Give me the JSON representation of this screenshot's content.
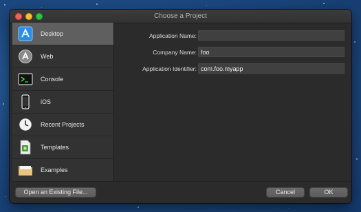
{
  "window": {
    "title": "Choose a Project"
  },
  "sidebar": {
    "items": [
      {
        "label": "Desktop",
        "icon": "desktop-app-icon",
        "selected": true
      },
      {
        "label": "Web",
        "icon": "web-app-icon",
        "selected": false
      },
      {
        "label": "Console",
        "icon": "console-icon",
        "selected": false
      },
      {
        "label": "iOS",
        "icon": "ios-device-icon",
        "selected": false
      },
      {
        "label": "Recent Projects",
        "icon": "clock-icon",
        "selected": false
      },
      {
        "label": "Templates",
        "icon": "templates-icon",
        "selected": false
      },
      {
        "label": "Examples",
        "icon": "folder-icon",
        "selected": false
      }
    ]
  },
  "form": {
    "application_name": {
      "label": "Application Name:",
      "value": ""
    },
    "company_name": {
      "label": "Company Name:",
      "value": "foo"
    },
    "application_identifier": {
      "label": "Application Identifier:",
      "value": "com.foo.myapp"
    }
  },
  "footer": {
    "open_existing_label": "Open an Existing File...",
    "cancel_label": "Cancel",
    "ok_label": "OK"
  },
  "colors": {
    "window_bg": "#2b2b2b",
    "sidebar_bg": "#323232",
    "selected_bg": "#5f5f5f",
    "desktop_bg": "#1d4a83"
  }
}
